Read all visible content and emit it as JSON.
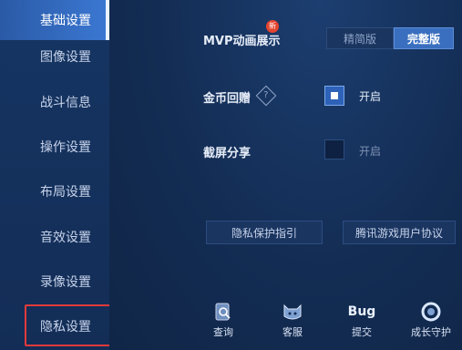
{
  "sidebar": {
    "items": [
      {
        "label": "基础设置"
      },
      {
        "label": "图像设置"
      },
      {
        "label": "战斗信息"
      },
      {
        "label": "操作设置"
      },
      {
        "label": "布局设置"
      },
      {
        "label": "音效设置"
      },
      {
        "label": "录像设置"
      },
      {
        "label": "隐私设置"
      }
    ]
  },
  "settings": {
    "mvp": {
      "label": "MVP动画展示",
      "badge": "新",
      "options": [
        "精简版",
        "完整版"
      ],
      "selected": "完整版"
    },
    "coin": {
      "label": "金币回赠",
      "help": "?",
      "option": "开启",
      "checked": true
    },
    "screenshot": {
      "label": "截屏分享",
      "option": "开启",
      "checked": false
    }
  },
  "links": {
    "privacy": "隐私保护指引",
    "agreement": "腾讯游戏用户协议"
  },
  "bottom": [
    {
      "label": "查询",
      "icon": "query-icon"
    },
    {
      "label": "客服",
      "icon": "customer-service-icon"
    },
    {
      "label": "提交",
      "icon": "bug-icon",
      "icon_text": "Bug"
    },
    {
      "label": "成长守护",
      "icon": "growth-guard-icon"
    }
  ],
  "colors": {
    "accent": "#3a6fbf",
    "highlight": "#e23a3a",
    "badge": "#e4452f"
  }
}
